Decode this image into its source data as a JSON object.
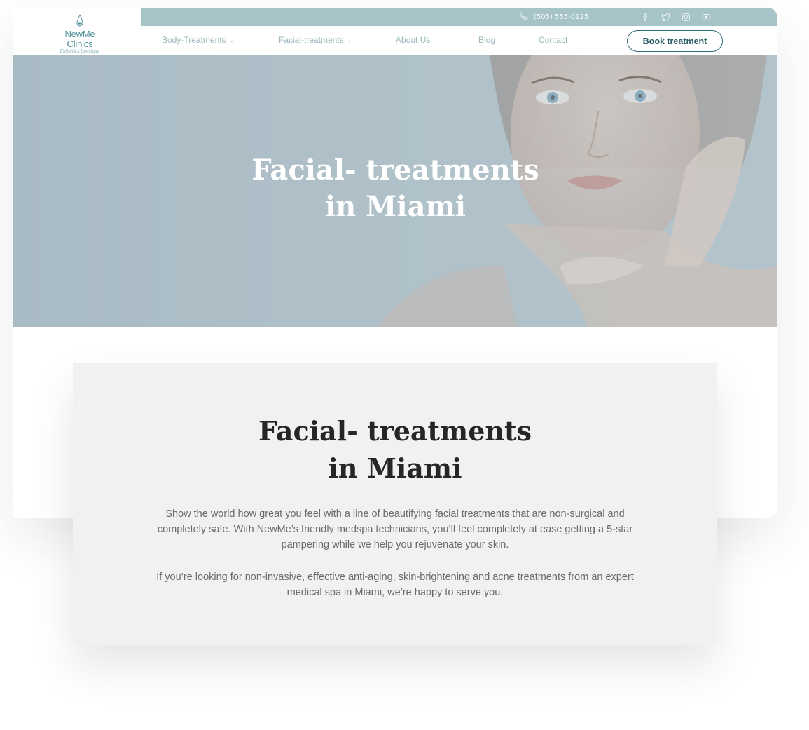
{
  "header": {
    "phone": "(505) 555-0125",
    "socials": [
      "facebook-icon",
      "twitter-icon",
      "instagram-icon",
      "youtube-icon"
    ],
    "logo": {
      "name": "NewMe Clinics",
      "tagline": "Esthetics boutique"
    }
  },
  "nav": {
    "items": [
      {
        "label": "Body-Treatments",
        "dropdown": true
      },
      {
        "label": "Facial-treatments",
        "dropdown": true
      },
      {
        "label": "About Us",
        "dropdown": false
      },
      {
        "label": "Blog",
        "dropdown": false
      },
      {
        "label": "Contact",
        "dropdown": false
      }
    ],
    "cta": "Book treatment"
  },
  "hero": {
    "title_line1": "Facial- treatments",
    "title_line2": "in Miami"
  },
  "content": {
    "title_line1": "Facial- treatments",
    "title_line2": "in Miami",
    "paragraph1": "Show the world how great you feel with a line of beautifying facial treatments that are non-surgical and completely safe. With NewMe’s friendly medspa technicians, you’ll feel completely at ease getting a 5-star pampering while we help you rejuvenate your skin.",
    "paragraph2": "If you’re looking for non-invasive, effective anti-aging, skin-brightening and acne treatments from an expert medical spa in Miami, we’re happy to serve you."
  },
  "colors": {
    "accent": "#a6c3c7",
    "brand_dark": "#2f6a73",
    "text_dark": "#262626",
    "text_body": "#6a6a6a",
    "card_bg": "#f1f1f1"
  }
}
